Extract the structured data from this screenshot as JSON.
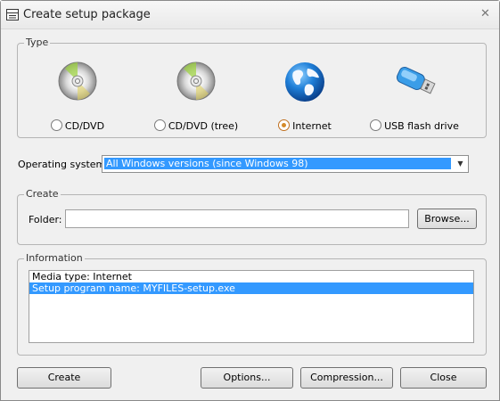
{
  "window": {
    "title": "Create setup package"
  },
  "type_group": {
    "legend": "Type",
    "options": [
      {
        "label": "CD/DVD",
        "icon": "cd-icon",
        "checked": false
      },
      {
        "label": "CD/DVD (tree)",
        "icon": "cd-icon",
        "checked": false
      },
      {
        "label": "Internet",
        "icon": "globe-icon",
        "checked": true
      },
      {
        "label": "USB flash drive",
        "icon": "usb-drive-icon",
        "checked": false
      }
    ]
  },
  "os": {
    "label": "Operating system:",
    "value": "All Windows versions (since Windows 98)"
  },
  "create_group": {
    "legend": "Create",
    "folder_label": "Folder:",
    "folder_value": "",
    "browse_label": "Browse..."
  },
  "info_group": {
    "legend": "Information",
    "rows": [
      {
        "text": "Media type: Internet",
        "selected": false
      },
      {
        "text": "Setup program name: MYFILES-setup.exe",
        "selected": true
      }
    ]
  },
  "buttons": {
    "create": "Create",
    "options": "Options...",
    "compression": "Compression...",
    "close": "Close"
  },
  "colors": {
    "selection": "#3399ff",
    "radio_checked": "#d58a2a"
  }
}
